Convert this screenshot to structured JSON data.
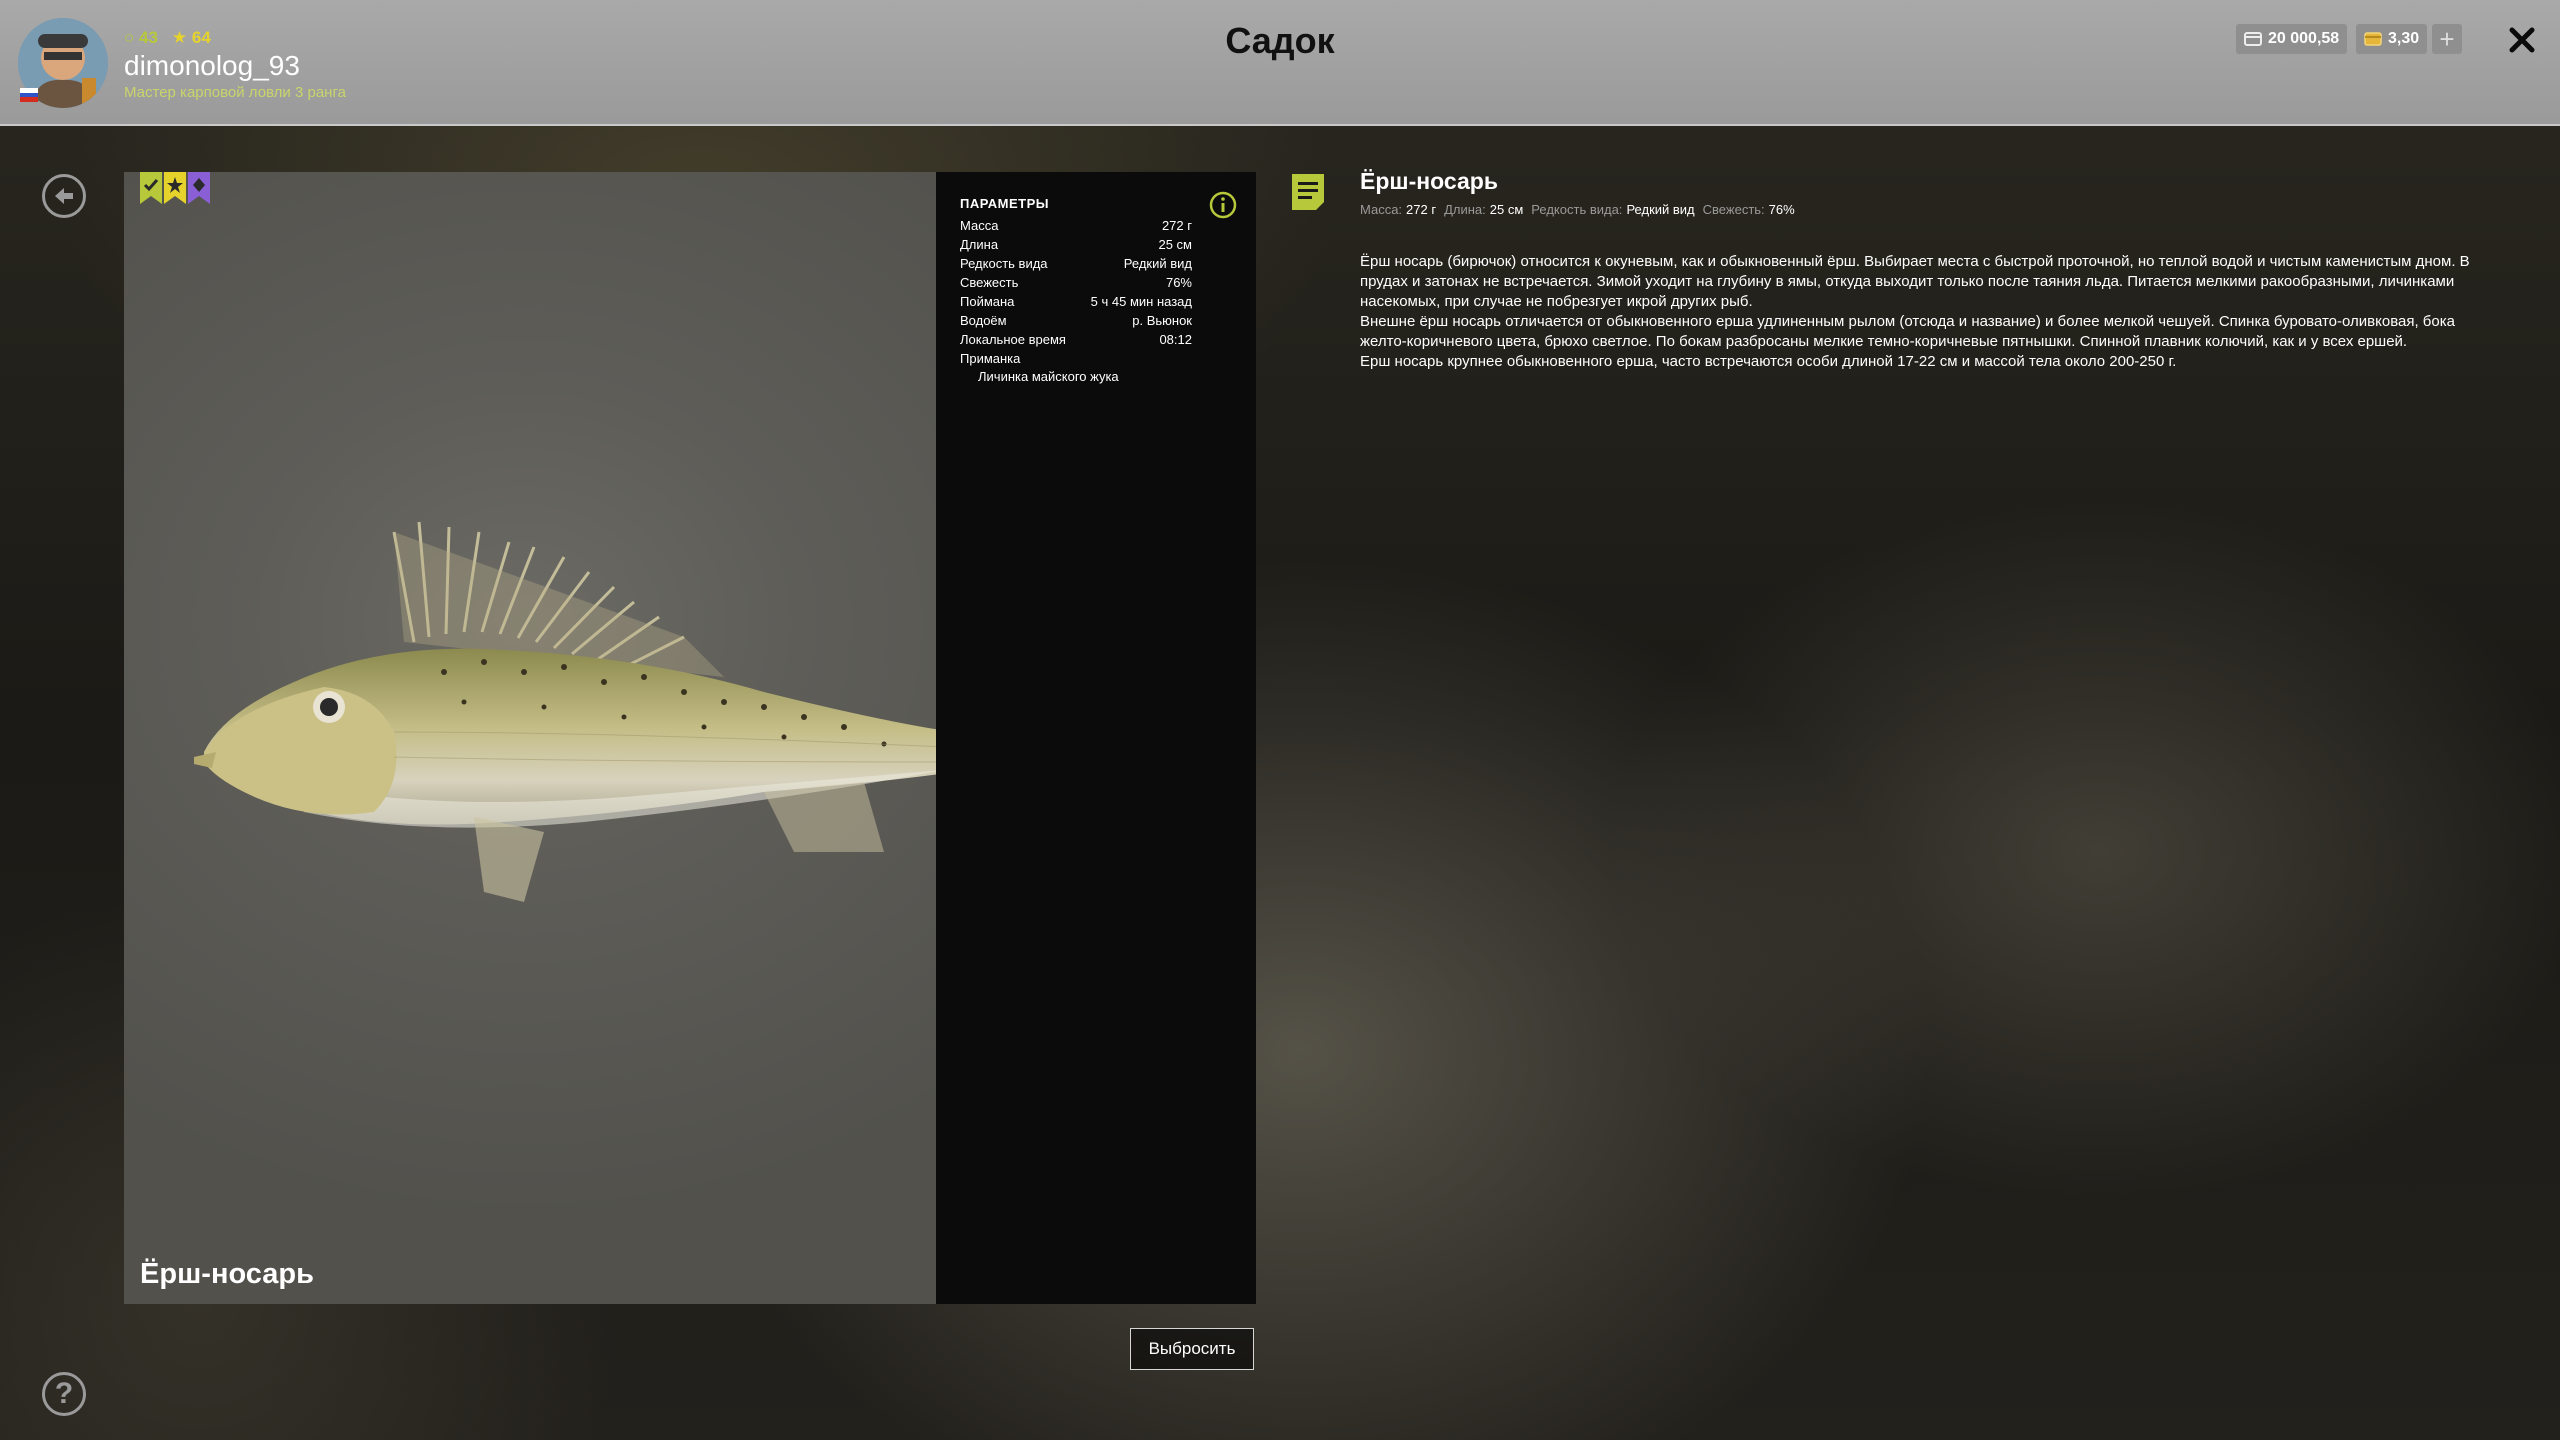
{
  "header": {
    "title": "Садок",
    "user": {
      "name": "dimonolog_93",
      "rank": "Мастер карповой ловли 3 ранга",
      "stat_level": "43",
      "stat_stars": "64"
    },
    "currency": {
      "silver": "20 000,58",
      "gold": "3,30"
    },
    "plus_label": "+"
  },
  "fish": {
    "name": "Ёрш-носарь",
    "badges": [
      "check-badge-green",
      "star-badge-yellow",
      "diamond-badge-purple"
    ]
  },
  "params": {
    "title": "ПАРАМЕТРЫ",
    "rows": [
      {
        "label": "Масса",
        "value": "272 г"
      },
      {
        "label": "Длина",
        "value": "25 см"
      },
      {
        "label": "Редкость вида",
        "value": "Редкий вид"
      },
      {
        "label": "Свежесть",
        "value": "76%"
      },
      {
        "label": "Поймана",
        "value": "5 ч 45 мин назад"
      },
      {
        "label": "Водоём",
        "value": "р. Вьюнок"
      },
      {
        "label": "Локальное время",
        "value": "08:12"
      }
    ],
    "bait_label": "Приманка",
    "bait_value": "Личинка майского жука"
  },
  "actions": {
    "discard": "Выбросить"
  },
  "description": {
    "title": "Ёрш-носарь",
    "meta": [
      {
        "label": "Масса:",
        "value": "272 г"
      },
      {
        "label": "Длина:",
        "value": "25 см"
      },
      {
        "label": "Редкость вида:",
        "value": "Редкий вид"
      },
      {
        "label": "Свежесть:",
        "value": "76%"
      }
    ],
    "paragraphs": [
      "Ёрш носарь (бирючок) относится к окуневым, как и обыкновенный ёрш. Выбирает места с быстрой проточной, но теплой водой и чистым каменистым дном. В прудах и затонах не встречается. Зимой уходит на глубину в ямы, откуда выходит только после таяния льда. Питается мелкими ракообразными, личинками насекомых, при случае не побрезгует икрой других рыб.",
      "Внешне ёрш носарь отличается от обыкновенного ерша удлиненным рылом (отсюда и название) и более мелкой чешуей. Спинка буровато-оливковая, бока желто-коричневого цвета, брюхо светлое. По бокам разбросаны мелкие темно-коричневые пятнышки. Спинной плавник колючий, как и у всех ершей.",
      "Ерш носарь крупнее обыкновенного ерша, часто встречаются особи длиной 17-22 см и массой тела около 200-250 г."
    ]
  },
  "icons": {
    "back": "back-arrow-icon",
    "help": "help-icon",
    "close": "close-icon",
    "info": "info-icon",
    "note": "note-icon"
  },
  "colors": {
    "accent_green": "#b7c93a",
    "accent_yellow": "#e5d32c",
    "accent_purple": "#8a5fd6"
  }
}
